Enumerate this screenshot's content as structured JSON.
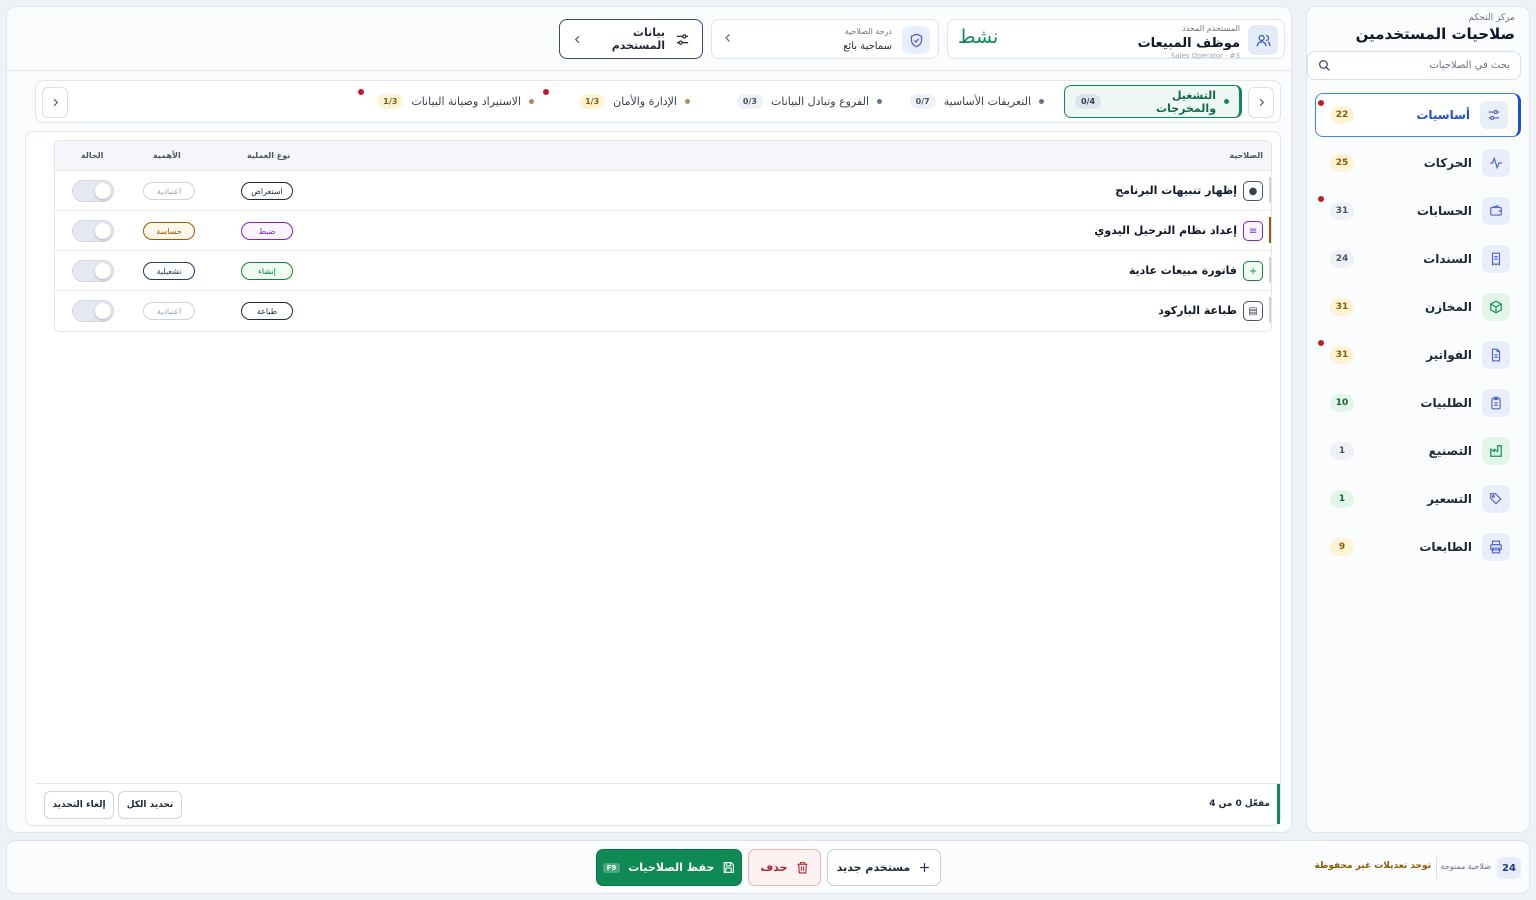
{
  "sidebar": {
    "subtitle": "مركز التحكم",
    "title": "صلاحيات المستخدمين",
    "search_placeholder": "بحث في الصلاحيات",
    "items": [
      {
        "label": "أساسيات",
        "count": "22",
        "icon": "sliders-icon",
        "count_color": "amber",
        "has_alert": true,
        "active": true
      },
      {
        "label": "الحركات",
        "count": "25",
        "icon": "activity-icon",
        "count_color": "amber",
        "has_alert": false
      },
      {
        "label": "الحسابات",
        "count": "31",
        "icon": "wallet-icon",
        "count_color": "gray",
        "has_alert": true
      },
      {
        "label": "السندات",
        "count": "24",
        "icon": "receipt-icon",
        "count_color": "gray",
        "has_alert": false
      },
      {
        "label": "المخازن",
        "count": "31",
        "icon": "box-icon",
        "count_color": "amber",
        "has_alert": false
      },
      {
        "label": "الفواتير",
        "count": "31",
        "icon": "invoice-icon",
        "count_color": "amber",
        "has_alert": true
      },
      {
        "label": "الطلبيات",
        "count": "10",
        "icon": "clipboard-icon",
        "count_color": "green",
        "has_alert": false
      },
      {
        "label": "التصنيع",
        "count": "1",
        "icon": "factory-icon",
        "count_color": "gray",
        "has_alert": false
      },
      {
        "label": "التسعير",
        "count": "1",
        "icon": "tag-icon",
        "count_color": "green",
        "has_alert": false
      },
      {
        "label": "الطابعات",
        "count": "9",
        "icon": "printer-icon",
        "count_color": "amber",
        "has_alert": false
      }
    ]
  },
  "header": {
    "user": {
      "label": "المستخدم المحدد",
      "name": "موظف المبيعات",
      "id_text": "Sales Operator · #3",
      "status": "نشط"
    },
    "role": {
      "label": "درجة الصلاحية",
      "value": "سماحية بائع"
    },
    "user_data_button": "بيانات المستخدم"
  },
  "tabs": [
    {
      "label": "التشغيل والمخرجات",
      "count": "0/4",
      "active": true
    },
    {
      "label": "التعريفات الأساسية",
      "count": "0/7"
    },
    {
      "label": "الفروع وتبادل البيانات",
      "count": "0/3"
    },
    {
      "label": "الإدارة والأمان",
      "count": "1/3",
      "alert": true
    },
    {
      "label": "الاستيراد وصيانة البيانات",
      "count": "1/3",
      "alert": true
    }
  ],
  "table": {
    "headers": {
      "permission": "الصلاحية",
      "op_type": "نوع العملية",
      "importance": "الأهمية",
      "status": "الحالة"
    },
    "rows": [
      {
        "name": "إظهار تنبيهات البرنامج",
        "icon_glyph": "●",
        "op": "استعراض",
        "importance": "اعتيادية",
        "bar_color": "#cbd5e1",
        "op_color": "#1f2937",
        "imp_color": "#9ca3af",
        "enabled": false
      },
      {
        "name": "إعداد نظام الترحيل اليدوي",
        "icon_glyph": "≡",
        "op": "ضبط",
        "importance": "حساسة",
        "bar_color": "#9a5a00",
        "op_color": "#7e22ce",
        "imp_color": "#9a5a00",
        "enabled": false
      },
      {
        "name": "فاتورة مبيعات عادية",
        "icon_glyph": "+",
        "op": "إنشاء",
        "importance": "تشغيلية",
        "bar_color": "#cbd5e1",
        "op_color": "#15803d",
        "imp_color": "#1e3a5f",
        "enabled": false
      },
      {
        "name": "طباعة الباركود",
        "icon_glyph": "▤",
        "op": "طباعة",
        "importance": "اعتيادية",
        "bar_color": "#cbd5e1",
        "op_color": "#1f2937",
        "imp_color": "#9ca3af",
        "enabled": false
      }
    ]
  },
  "table_footer": {
    "summary": "مفعّل 0 من 4",
    "select_all": "تحديد الكل",
    "deselect": "إلغاء التحديد"
  },
  "bottom_bar": {
    "granted_count": "24",
    "granted_label": "صلاحية ممنوحة",
    "unsaved_warning": "توجد تعديلات غير محفوظة",
    "new_user": "مستخدم جديد",
    "delete": "حذف",
    "save": "حفظ الصلاحيات",
    "save_shortcut": "F9"
  },
  "colors": {
    "accent_green": "#0f8a55",
    "accent_blue": "#1d4ed8",
    "alert_red": "#c01b2c",
    "warning_amber": "#8a5a00"
  }
}
